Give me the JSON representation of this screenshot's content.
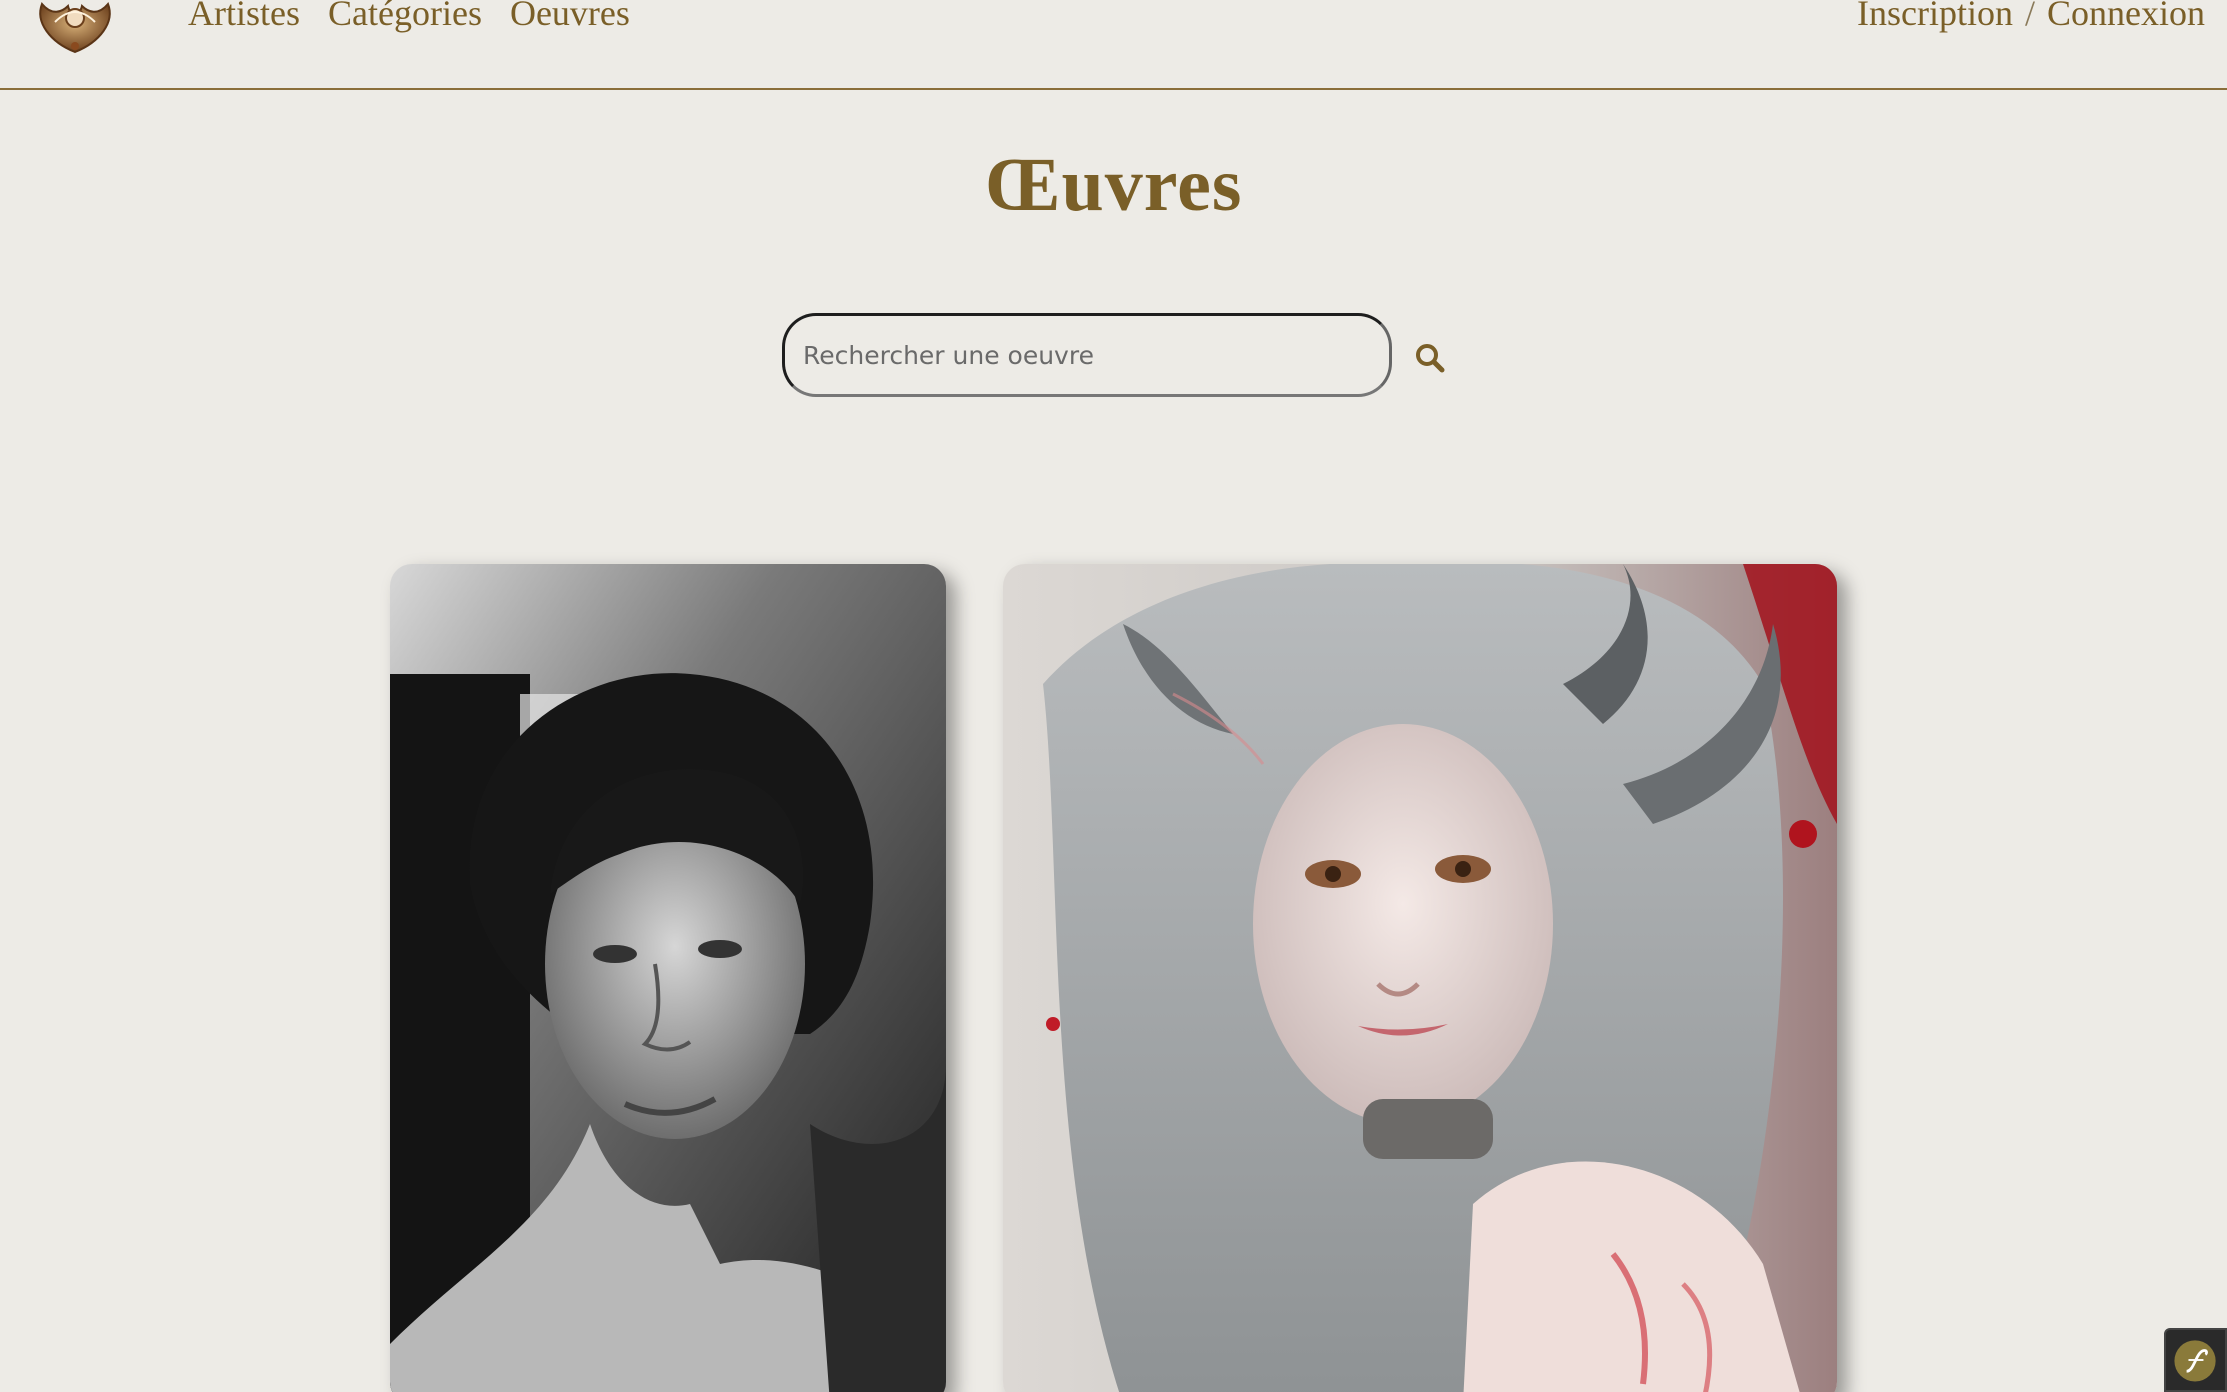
{
  "header": {
    "logo_icon": "ornate-crest-logo",
    "nav": [
      {
        "label": "Artistes"
      },
      {
        "label": "Catégories"
      },
      {
        "label": "Oeuvres"
      }
    ],
    "auth": {
      "register": "Inscription",
      "separator": "/",
      "login": "Connexion"
    }
  },
  "main": {
    "title": "Œuvres",
    "search": {
      "placeholder": "Rechercher une oeuvre",
      "value": "",
      "icon": "search-icon"
    },
    "artworks": [
      {
        "description_icon": "artwork-portrait-bw"
      },
      {
        "description_icon": "artwork-horned-girl"
      }
    ]
  },
  "debug": {
    "icon": "symfony-icon"
  },
  "colors": {
    "accent": "#7a5f28",
    "background": "#edebe6",
    "divider": "#8a6e3a"
  }
}
